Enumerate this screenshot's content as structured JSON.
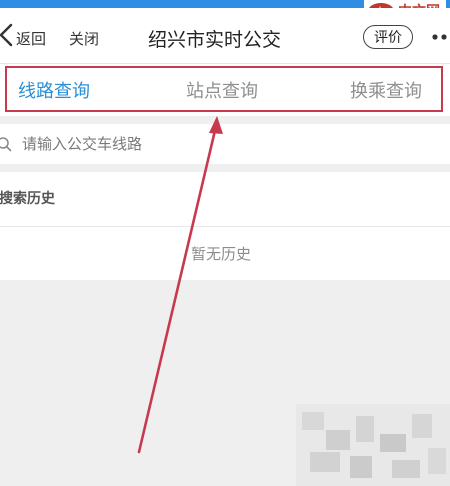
{
  "watermark": {
    "logo": "php",
    "text": "中文网"
  },
  "header": {
    "back_label": "返回",
    "close_label": "关闭",
    "title": "绍兴市实时公交",
    "rate_label": "评价"
  },
  "tabs": [
    {
      "label": "线路查询",
      "active": true
    },
    {
      "label": "站点查询",
      "active": false
    },
    {
      "label": "换乘查询",
      "active": false
    }
  ],
  "search": {
    "placeholder": "请输入公交车线路",
    "value": ""
  },
  "history": {
    "title": "搜索历史",
    "empty_text": "暂无历史"
  },
  "colors": {
    "active_tab": "#2b8fd6",
    "inactive_tab": "#8f8f8f",
    "highlight": "#c73a4e",
    "topbar": "#2f8de4",
    "background": "#efefef"
  },
  "icons": [
    "back-icon",
    "more-icon",
    "search-icon",
    "annotation-arrow"
  ]
}
